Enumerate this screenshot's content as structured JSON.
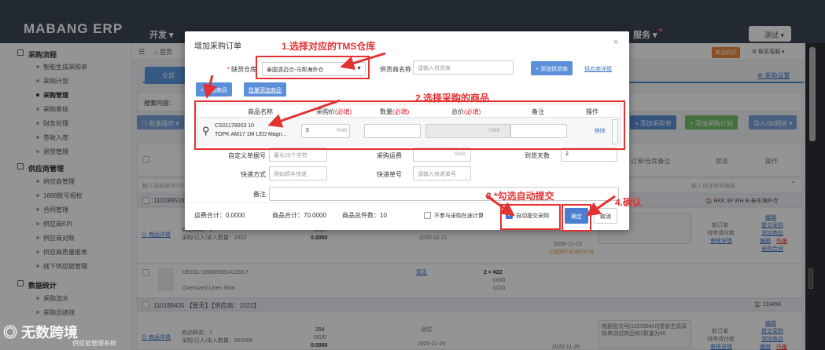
{
  "app": {
    "logo": "MABANG ERP",
    "nav_dev": "开发",
    "nav_service": "服务",
    "user_label": "测试"
  },
  "breadcrumb": {
    "home": "首页",
    "right_badge": "单品购买",
    "right_link": "联系客服"
  },
  "sidebar": {
    "section1": "采购流程",
    "items1": [
      "智能生成采购单",
      "采购计划",
      "采购管理",
      "采购审核",
      "财务处理",
      "签收入库",
      "退货管理"
    ],
    "active_index": 2,
    "section2": "供应商管理",
    "items2": [
      "供应商管理",
      "1688账号授权",
      "合同管理",
      "供应商KPI",
      "供应商对账",
      "供应商质量报表",
      "线下供应链管理"
    ],
    "section3": "数据统计",
    "items3": [
      "采购流水",
      "采购员绩效"
    ]
  },
  "main": {
    "tab_all": "全部",
    "setting_link": "采购设置",
    "search_label": "搜索内容:",
    "batch_btn": "批量操作",
    "add_po_btn": "添加采购单",
    "add_plan_btn": "添加采购计划",
    "import_btn": "导入/3d相关",
    "headers": [
      "订单/仓库备注",
      "状态",
      "操作"
    ],
    "filter_placeholder": "输入采购单号/SK",
    "filter_placeholder_right": "输入快递单号搜索",
    "warehouse_right": "BKK 3P WH B-泰东海外仓",
    "orders": [
      {
        "id": "110199516",
        "goods_link": "商品详情",
        "type_count": "商品种类：1",
        "qty": "采购/已入/未入数量：2/0/2",
        "nums": "0/0/0",
        "amount": "0.0000",
        "date1": "2020-12-21",
        "date2": "2020-12-23",
        "overdue": "已超时7天3时37分",
        "status1": "新订单",
        "status2": "待申请付款",
        "status3": "审核详情",
        "ops": [
          "编辑",
          "提交采购",
          "添加商品",
          "编辑",
          "作废",
          "采购合同"
        ]
      },
      {
        "sku": "DES11-19988598141193.7",
        "name": "Oversized Linen Shirt",
        "tag": "暂无",
        "qty_line": "2 × ¥22",
        "nums": "0/0/0",
        "nums2": "0/2/0"
      },
      {
        "id": "110199435",
        "meta": "【暂无】【供应商：1022】",
        "right": "123456",
        "goods_link": "商品详情",
        "type_count": "商品种类：1",
        "qty": "采购/已入/未入数量：66/0/66",
        "top_num": "264",
        "nums": "0/0/0",
        "amount": "0.0000",
        "supplier_tag": "测试",
        "date1": "2020-11-26",
        "date2": "2020-11-26",
        "note": "根据批次号[110199410]重新生成采购单测试商品和1数量为66",
        "status1": "新订单",
        "status2": "待申请付款",
        "status3": "审核详情",
        "ops": [
          "编辑",
          "提交采购",
          "添加商品",
          "编辑",
          "作废"
        ]
      }
    ]
  },
  "modal": {
    "title": "增加采购订单",
    "warehouse_label": "缺货仓库",
    "warehouse_value": "泰国清迈仓-马帮海外仓",
    "supplier_label": "供货商名称",
    "supplier_placeholder": "请输入供货商",
    "add_supplier_btn": "+ 添加供货商",
    "supplier_detail_link": "供应商详情",
    "add_goods_btn": "+ 添加商品",
    "batch_add_goods_btn": "批量添加商品",
    "goods_headers": {
      "name": "商品名称",
      "price": "采购价",
      "qty": "数量",
      "total": "总价",
      "remark": "备注",
      "op": "操作",
      "required": "(必填)"
    },
    "goods_row": {
      "sku": "CS01178003 10",
      "name": "TOPK AM17 1M LED Magn...",
      "qty": "5",
      "rmb": "RMB",
      "remove": "移除"
    },
    "custom_no_label": "自定义单据号",
    "custom_no_placeholder": "最长20个字符",
    "freight_label": "采购运费",
    "freight_rmb": "RMB",
    "arrival_label": "到货天数",
    "arrival_value": "2",
    "express_label": "快递方式",
    "express_placeholder": "例如顺丰快递",
    "express_no_label": "快递单号",
    "express_no_placeholder": "请输入快递单号",
    "remark_label": "备注",
    "footer": {
      "freight_total": "运费合计：0.0000",
      "goods_total": "商品合计：70.0000",
      "goods_count": "商品总件数：10",
      "not_in_transit": "不参与采购在途计算",
      "auto_submit": "自动提交采购",
      "confirm": "确定",
      "cancel": "取消"
    }
  },
  "annotations": {
    "step1": "1.选择对应的TMS仓库",
    "step2": "2.选择采购的商品",
    "step3": "3.*勾选自动提交",
    "step4": "4.确认"
  },
  "watermark": {
    "brand": "无数跨境",
    "sub": "供应链管理系统"
  },
  "colors": {
    "accent": "#5b8fd9",
    "annotation": "#e33232",
    "topbar": "#3d4757"
  }
}
